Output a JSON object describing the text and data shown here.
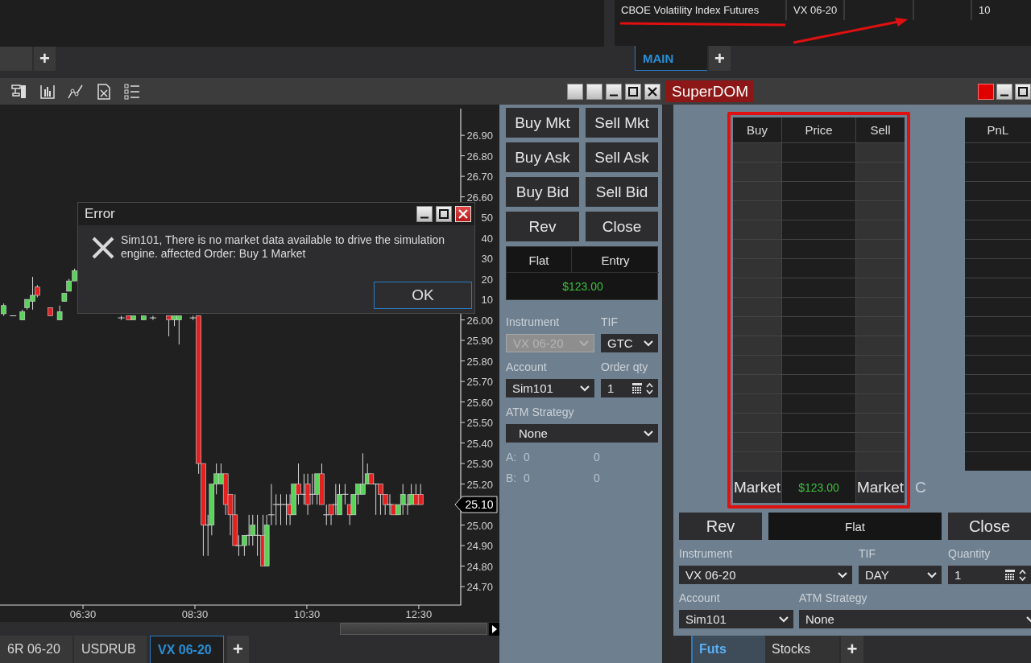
{
  "workspace_tabs": {
    "add_tab": "+"
  },
  "instrument_list": {
    "row": {
      "column_1": "CBOE Volatility Index Futures",
      "column_2": "VX 06-20",
      "column_5": "10"
    },
    "tabs": [
      {
        "label": "MAIN",
        "selected": true
      }
    ],
    "add_tab": "+"
  },
  "chart_window": {
    "chart_data": {
      "type": "candlestick",
      "x": [
        305,
        315,
        325,
        330,
        336,
        341,
        355,
        365,
        370,
        375,
        381,
        431,
        439,
        444,
        455,
        465,
        482,
        488,
        493,
        508,
        514,
        519,
        524,
        528,
        533,
        538,
        543,
        548,
        553,
        557,
        563,
        568,
        572,
        577,
        583,
        587,
        592,
        597,
        602,
        608,
        612,
        616,
        621,
        627,
        631,
        636,
        641,
        646,
        651,
        656,
        661,
        665,
        671,
        676,
        680,
        685,
        690,
        695,
        699,
        704,
        709,
        714,
        719,
        723,
        728,
        733,
        738,
        742,
        747,
        752
      ],
      "ohlc": [
        [
          26.03,
          26.08,
          26.02,
          26.07
        ],
        [
          26.02,
          26.02,
          26.02,
          26.02
        ],
        [
          26.0,
          26.05,
          26.0,
          26.04
        ],
        [
          26.06,
          26.1,
          26.05,
          26.1
        ],
        [
          26.09,
          26.21,
          26.05,
          26.12
        ],
        [
          26.16,
          26.17,
          26.11,
          26.12
        ],
        [
          26.06,
          26.06,
          26.02,
          26.02
        ],
        [
          26.0,
          26.07,
          26.0,
          26.04
        ],
        [
          26.09,
          26.13,
          26.09,
          26.13
        ],
        [
          26.14,
          26.2,
          26.14,
          26.19
        ],
        [
          26.19,
          26.25,
          26.19,
          26.24
        ],
        [
          26.01,
          26.02,
          26.0,
          26.01
        ],
        [
          26.02,
          26.02,
          26.0,
          26.0
        ],
        [
          26.0,
          26.02,
          26.0,
          26.02
        ],
        [
          26.0,
          26.02,
          26.0,
          26.02
        ],
        [
          26.01,
          26.02,
          26.0,
          26.01
        ],
        [
          26.02,
          26.02,
          25.92,
          26.0
        ],
        [
          26.0,
          26.02,
          25.97,
          26.02
        ],
        [
          26.0,
          26.02,
          25.88,
          26.02
        ],
        [
          26.01,
          26.02,
          26.0,
          26.01
        ],
        [
          26.02,
          26.02,
          25.25,
          25.3
        ],
        [
          25.3,
          25.3,
          24.85,
          25.0
        ],
        [
          25.0,
          25.05,
          24.85,
          25.0
        ],
        [
          25.0,
          25.2,
          24.95,
          25.2
        ],
        [
          25.2,
          25.3,
          25.15,
          25.25
        ],
        [
          25.2,
          25.3,
          25.2,
          25.25
        ],
        [
          25.25,
          25.25,
          25.05,
          25.1
        ],
        [
          25.15,
          25.15,
          24.95,
          25.05
        ],
        [
          25.05,
          25.15,
          24.9,
          24.9
        ],
        [
          24.9,
          24.95,
          24.85,
          24.9
        ],
        [
          24.9,
          24.95,
          24.85,
          24.95
        ],
        [
          24.95,
          25.05,
          24.9,
          24.95
        ],
        [
          24.95,
          25.05,
          24.9,
          25.0
        ],
        [
          24.95,
          25.05,
          24.85,
          24.95
        ],
        [
          24.95,
          25.05,
          24.8,
          24.8
        ],
        [
          24.8,
          25.05,
          24.8,
          25.0
        ],
        [
          25.05,
          25.2,
          25.0,
          25.05
        ],
        [
          25.1,
          25.15,
          25.0,
          25.1
        ],
        [
          25.1,
          25.15,
          25.0,
          25.1
        ],
        [
          25.1,
          25.15,
          25.0,
          25.1
        ],
        [
          25.1,
          25.15,
          25.0,
          25.05
        ],
        [
          25.05,
          25.2,
          25.05,
          25.2
        ],
        [
          25.2,
          25.3,
          25.1,
          25.15
        ],
        [
          25.15,
          25.25,
          25.1,
          25.15
        ],
        [
          25.2,
          25.25,
          25.05,
          25.1
        ],
        [
          25.15,
          25.25,
          25.1,
          25.15
        ],
        [
          25.15,
          25.25,
          25.1,
          25.25
        ],
        [
          25.25,
          25.3,
          25.1,
          25.1
        ],
        [
          25.05,
          25.1,
          25.0,
          25.05
        ],
        [
          25.1,
          25.1,
          25.0,
          25.05
        ],
        [
          25.1,
          25.2,
          25.05,
          25.1
        ],
        [
          25.05,
          25.2,
          25.05,
          25.15
        ],
        [
          25.15,
          25.2,
          25.1,
          25.15
        ],
        [
          25.1,
          25.1,
          25.0,
          25.05
        ],
        [
          25.05,
          25.15,
          25.05,
          25.15
        ],
        [
          25.15,
          25.2,
          25.1,
          25.2
        ],
        [
          25.15,
          25.35,
          25.15,
          25.2
        ],
        [
          25.2,
          25.3,
          25.2,
          25.25
        ],
        [
          25.25,
          25.25,
          25.2,
          25.2
        ],
        [
          25.2,
          25.2,
          25.05,
          25.2
        ],
        [
          25.2,
          25.2,
          25.05,
          25.15
        ],
        [
          25.15,
          25.15,
          25.05,
          25.1
        ],
        [
          25.1,
          25.15,
          25.05,
          25.1
        ],
        [
          25.1,
          25.1,
          25.05,
          25.05
        ],
        [
          25.05,
          25.1,
          25.05,
          25.1
        ],
        [
          25.1,
          25.2,
          25.05,
          25.15
        ],
        [
          25.1,
          25.15,
          25.05,
          25.1
        ],
        [
          25.1,
          25.2,
          25.1,
          25.15
        ],
        [
          25.15,
          25.2,
          25.1,
          25.1
        ],
        [
          25.15,
          25.2,
          25.1,
          25.1
        ]
      ],
      "yticks": [
        {
          "value": 26.9,
          "label": "26.90"
        },
        {
          "value": 26.8,
          "label": "26.80"
        },
        {
          "value": 26.7,
          "label": "26.70"
        },
        {
          "value": 26.6,
          "label": "26.60"
        },
        {
          "value": 26.0,
          "label": "26.00"
        },
        {
          "value": 25.9,
          "label": "25.90"
        },
        {
          "value": 25.8,
          "label": "25.80"
        },
        {
          "value": 25.7,
          "label": "25.70"
        },
        {
          "value": 25.6,
          "label": "25.60"
        },
        {
          "value": 25.5,
          "label": "25.50"
        },
        {
          "value": 25.4,
          "label": "25.40"
        },
        {
          "value": 25.3,
          "label": "25.30"
        },
        {
          "value": 25.2,
          "label": "25.20"
        },
        {
          "value": 25.0,
          "label": "25.00"
        },
        {
          "value": 24.9,
          "label": "24.90"
        },
        {
          "value": 24.8,
          "label": "24.80"
        },
        {
          "value": 24.7,
          "label": "24.70"
        }
      ],
      "xticks": [
        {
          "value": 390,
          "label": "06:30"
        },
        {
          "value": 510,
          "label": "08:30"
        },
        {
          "value": 630,
          "label": "10:30"
        },
        {
          "value": 750,
          "label": "12:30"
        }
      ],
      "xlim": [
        301,
        795
      ],
      "ylim": [
        24.61,
        27.03
      ]
    },
    "covered_tick_labels": [
      "50",
      "40",
      "30",
      "20",
      "10"
    ],
    "last_price": "25.10",
    "tabs": [
      {
        "label": "6R 06-20",
        "selected": false
      },
      {
        "label": "USDRUB",
        "selected": false
      },
      {
        "label": "VX 06-20",
        "selected": true
      }
    ],
    "add_tab": "+"
  },
  "error_dialog": {
    "title": "Error",
    "message": "Sim101, There is no market data available to drive the simulation engine. affected Order: Buy 1 Market",
    "button": "OK"
  },
  "order_panel": {
    "buttons": [
      "Buy Mkt",
      "Sell Mkt",
      "Buy Ask",
      "Sell Ask",
      "Buy Bid",
      "Sell Bid",
      "Rev",
      "Close"
    ],
    "position": {
      "status": "Flat",
      "entry_label": "Entry",
      "pnl": "$123.00"
    },
    "field_rows": [
      [
        {
          "label": "Instrument",
          "value": "VX 06-20",
          "kind": "dropdown",
          "disabled": true
        },
        {
          "label": "TIF",
          "value": "GTC",
          "kind": "dropdown",
          "disabled": false
        }
      ],
      [
        {
          "label": "Account",
          "value": "Sim101",
          "kind": "dropdown",
          "disabled": false
        },
        {
          "label": "Order qty",
          "value": "1",
          "kind": "spinner",
          "disabled": false
        }
      ],
      [
        {
          "label": "ATM Strategy",
          "value": "None",
          "kind": "dropdown",
          "disabled": false
        }
      ]
    ],
    "stats": [
      {
        "label": "A:",
        "value_1": "0",
        "value_2": "0"
      },
      {
        "label": "B:",
        "value_1": "0",
        "value_2": "0"
      }
    ]
  },
  "superdom": {
    "title": "SuperDOM",
    "ladder": {
      "columns": [
        "Buy",
        "Price",
        "Sell"
      ],
      "footer": [
        "Market",
        "$123.00",
        "Market"
      ]
    },
    "side_label": "C",
    "pnl_header": "PnL",
    "actions": [
      {
        "label": "Rev",
        "kind": "button"
      },
      {
        "label": "Flat",
        "kind": "status"
      },
      {
        "label": "Close",
        "kind": "button"
      }
    ],
    "field_rows": [
      [
        {
          "label": "Instrument",
          "value": "VX 06-20",
          "kind": "dropdown"
        },
        {
          "label": "TIF",
          "value": "DAY",
          "kind": "dropdown"
        },
        {
          "label": "Quantity",
          "value": "1",
          "kind": "spinner"
        }
      ],
      [
        {
          "label": "Account",
          "value": "Sim101",
          "kind": "dropdown"
        },
        {
          "label": "ATM Strategy",
          "value": "None",
          "kind": "dropdown"
        }
      ]
    ],
    "tabs": [
      {
        "label": "Futs",
        "selected": true
      },
      {
        "label": "Stocks",
        "selected": false
      }
    ],
    "add_tab": "+"
  }
}
